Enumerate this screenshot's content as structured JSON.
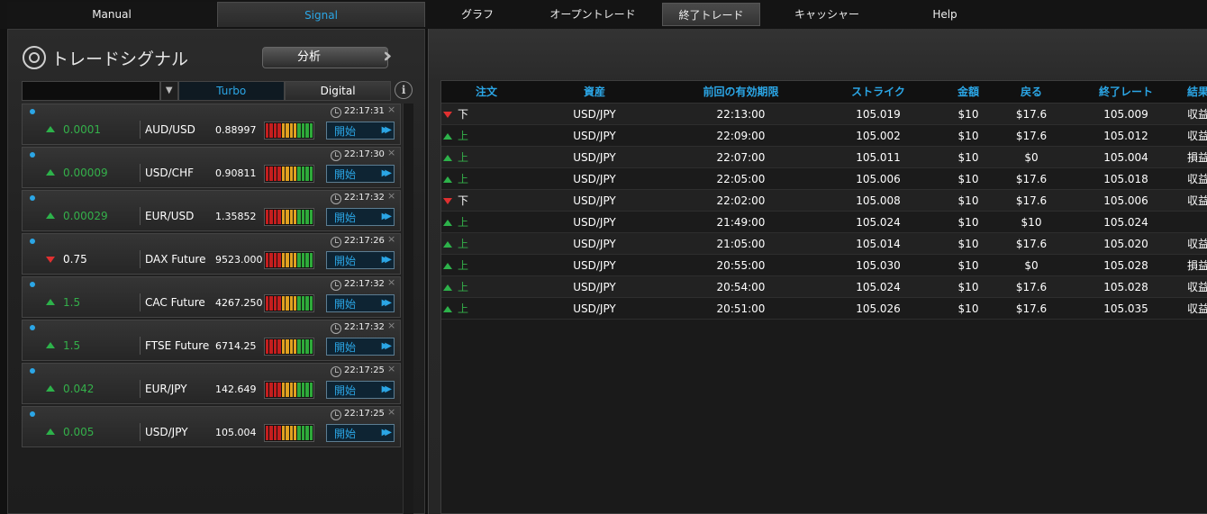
{
  "tabs_left": [
    {
      "label": "Manual",
      "active": false
    },
    {
      "label": "Signal",
      "active": true
    }
  ],
  "tabs_right": [
    {
      "label": "グラフ",
      "active": false
    },
    {
      "label": "オープントレード",
      "active": false
    },
    {
      "label": "終了トレード",
      "active": true
    },
    {
      "label": "キャッシャー",
      "active": false
    },
    {
      "label": "Help",
      "active": false
    }
  ],
  "signal_panel": {
    "title": "トレードシグナル",
    "analyze_label": "分析",
    "filter_value": "",
    "turbo_label": "Turbo",
    "digital_label": "Digital",
    "info_icon": "i"
  },
  "signals": [
    {
      "time": "22:17:31",
      "direction": "up",
      "change": "0.0001",
      "asset": "AUD/USD",
      "price": "0.88997",
      "start": "開始"
    },
    {
      "time": "22:17:30",
      "direction": "up",
      "change": "0.00009",
      "asset": "USD/CHF",
      "price": "0.90811",
      "start": "開始"
    },
    {
      "time": "22:17:32",
      "direction": "up",
      "change": "0.00029",
      "asset": "EUR/USD",
      "price": "1.35852",
      "start": "開始"
    },
    {
      "time": "22:17:26",
      "direction": "down",
      "change": "0.75",
      "asset": "DAX Future",
      "price": "9523.000",
      "start": "開始"
    },
    {
      "time": "22:17:32",
      "direction": "up",
      "change": "1.5",
      "asset": "CAC Future",
      "price": "4267.250",
      "start": "開始"
    },
    {
      "time": "22:17:32",
      "direction": "up",
      "change": "1.5",
      "asset": "FTSE Future",
      "price": "6714.25",
      "start": "開始"
    },
    {
      "time": "22:17:25",
      "direction": "up",
      "change": "0.042",
      "asset": "EUR/JPY",
      "price": "142.649",
      "start": "開始"
    },
    {
      "time": "22:17:25",
      "direction": "up",
      "change": "0.005",
      "asset": "USD/JPY",
      "price": "105.004",
      "start": "開始"
    }
  ],
  "meter_colors": [
    "#c41e1e",
    "#c41e1e",
    "#c41e1e",
    "#c41e1e",
    "#e0a020",
    "#e0a020",
    "#e0a020",
    "#e0a020",
    "#2eaa3a",
    "#2eaa3a",
    "#2eaa3a",
    "#2eaa3a"
  ],
  "closed_trades": {
    "headers": [
      "注文",
      "資産",
      "前回の有効期限",
      "ストライク",
      "金額",
      "戻る",
      "終了レート",
      "結果"
    ],
    "rows": [
      {
        "direction": "down",
        "order": "下",
        "asset": "USD/JPY",
        "expiry": "22:13:00",
        "strike": "105.019",
        "amount": "$10",
        "return": "$17.6",
        "close_rate": "105.009",
        "result": "収益"
      },
      {
        "direction": "up",
        "order": "上",
        "asset": "USD/JPY",
        "expiry": "22:09:00",
        "strike": "105.002",
        "amount": "$10",
        "return": "$17.6",
        "close_rate": "105.012",
        "result": "収益"
      },
      {
        "direction": "up",
        "order": "上",
        "asset": "USD/JPY",
        "expiry": "22:07:00",
        "strike": "105.011",
        "amount": "$10",
        "return": "$0",
        "close_rate": "105.004",
        "result": "損益"
      },
      {
        "direction": "up",
        "order": "上",
        "asset": "USD/JPY",
        "expiry": "22:05:00",
        "strike": "105.006",
        "amount": "$10",
        "return": "$17.6",
        "close_rate": "105.018",
        "result": "収益"
      },
      {
        "direction": "down",
        "order": "下",
        "asset": "USD/JPY",
        "expiry": "22:02:00",
        "strike": "105.008",
        "amount": "$10",
        "return": "$17.6",
        "close_rate": "105.006",
        "result": "収益"
      },
      {
        "direction": "up",
        "order": "上",
        "asset": "USD/JPY",
        "expiry": "21:49:00",
        "strike": "105.024",
        "amount": "$10",
        "return": "$10",
        "close_rate": "105.024",
        "result": ""
      },
      {
        "direction": "up",
        "order": "上",
        "asset": "USD/JPY",
        "expiry": "21:05:00",
        "strike": "105.014",
        "amount": "$10",
        "return": "$17.6",
        "close_rate": "105.020",
        "result": "収益"
      },
      {
        "direction": "up",
        "order": "上",
        "asset": "USD/JPY",
        "expiry": "20:55:00",
        "strike": "105.030",
        "amount": "$10",
        "return": "$0",
        "close_rate": "105.028",
        "result": "損益"
      },
      {
        "direction": "up",
        "order": "上",
        "asset": "USD/JPY",
        "expiry": "20:54:00",
        "strike": "105.024",
        "amount": "$10",
        "return": "$17.6",
        "close_rate": "105.028",
        "result": "収益"
      },
      {
        "direction": "up",
        "order": "上",
        "asset": "USD/JPY",
        "expiry": "20:51:00",
        "strike": "105.026",
        "amount": "$10",
        "return": "$17.6",
        "close_rate": "105.035",
        "result": "収益"
      }
    ]
  }
}
